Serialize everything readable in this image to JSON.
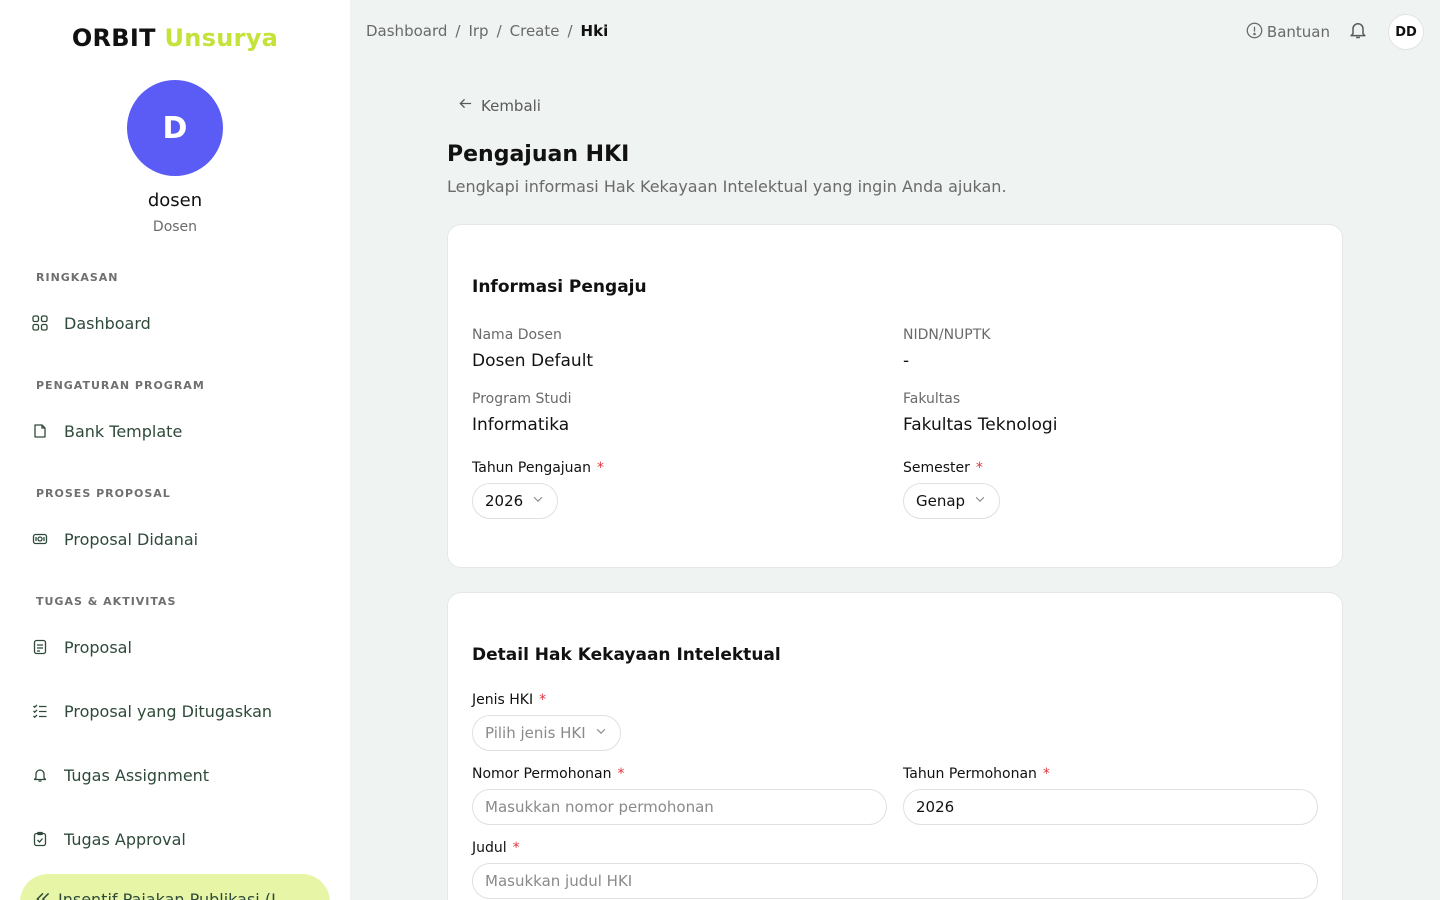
{
  "brand": {
    "part1": "ORBIT",
    "part2": "Unsurya"
  },
  "user": {
    "initial": "D",
    "name": "dosen",
    "role": "Dosen",
    "top_initials": "DD"
  },
  "sidebar": {
    "sections": [
      {
        "label": "RINGKASAN"
      },
      {
        "label": "PENGATURAN PROGRAM"
      },
      {
        "label": "PROSES PROPOSAL"
      },
      {
        "label": "TUGAS & AKTIVITAS"
      }
    ],
    "items": [
      {
        "label": "Dashboard",
        "icon": "grid-icon"
      },
      {
        "label": "Bank Template",
        "icon": "file-icon"
      },
      {
        "label": "Proposal Didanai",
        "icon": "money-icon"
      },
      {
        "label": "Proposal",
        "icon": "document-icon"
      },
      {
        "label": "Proposal yang Ditugaskan",
        "icon": "checklist-icon"
      },
      {
        "label": "Tugas Assignment",
        "icon": "bell-icon"
      },
      {
        "label": "Tugas Approval",
        "icon": "clipboard-check-icon"
      },
      {
        "label": "Insentif Pajakan Publikasi (I",
        "icon": "double-chevron-left-icon"
      }
    ]
  },
  "breadcrumb": [
    "Dashboard",
    "Irp",
    "Create",
    "Hki"
  ],
  "topbar": {
    "help_label": "Bantuan"
  },
  "page": {
    "back_label": "Kembali",
    "title": "Pengajuan HKI",
    "subtitle": "Lengkapi informasi Hak Kekayaan Intelektual yang ingin Anda ajukan."
  },
  "card_pengaju": {
    "title": "Informasi Pengaju",
    "nama_dosen_label": "Nama Dosen",
    "nama_dosen_value": "Dosen Default",
    "nidn_label": "NIDN/NUPTK",
    "nidn_value": "-",
    "prodi_label": "Program Studi",
    "prodi_value": "Informatika",
    "fakultas_label": "Fakultas",
    "fakultas_value": "Fakultas Teknologi",
    "tahun_label": "Tahun Pengajuan",
    "tahun_value": "2026",
    "semester_label": "Semester",
    "semester_value": "Genap",
    "required_mark": "*"
  },
  "card_hki": {
    "title": "Detail Hak Kekayaan Intelektual",
    "jenis_label": "Jenis HKI",
    "jenis_placeholder": "Pilih jenis HKI",
    "nomor_label": "Nomor Permohonan",
    "nomor_placeholder": "Masukkan nomor permohonan",
    "tahun_label": "Tahun Permohonan",
    "tahun_value": "2026",
    "judul_label": "Judul",
    "judul_placeholder": "Masukkan judul HKI",
    "required_mark": "*"
  }
}
